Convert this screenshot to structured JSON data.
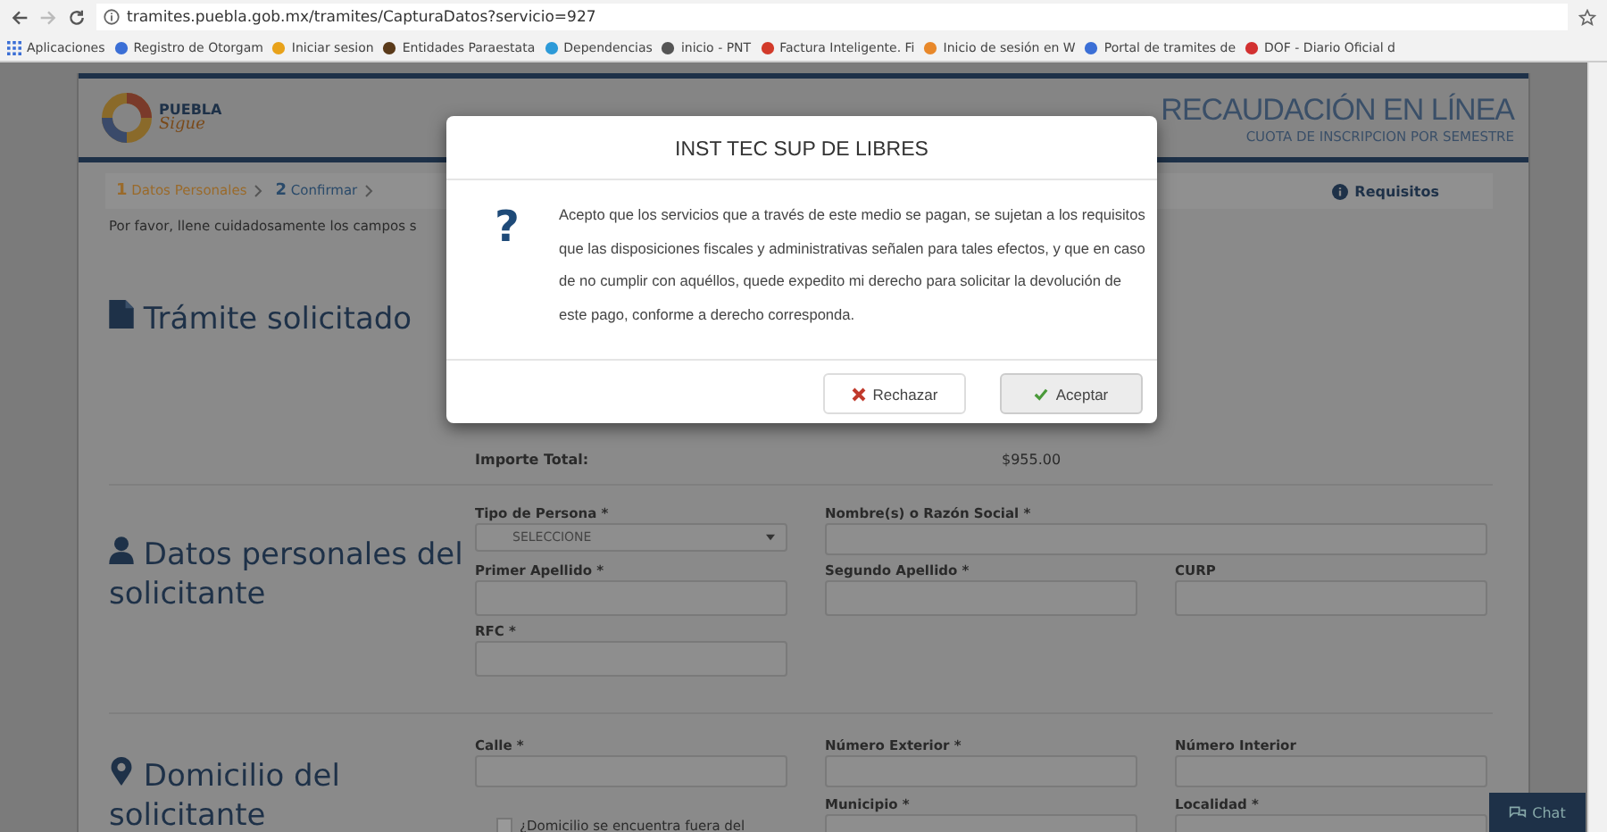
{
  "browser": {
    "url": "tramites.puebla.gob.mx/tramites/CapturaDatos?servicio=927",
    "bookmarks": [
      "Aplicaciones",
      "Registro de Otorgam",
      "Iniciar sesion",
      "Entidades Paraestata",
      "Dependencias",
      "inicio - PNT",
      "Factura Inteligente. Fi",
      "Inicio de sesión en W",
      "Portal de tramites de",
      "DOF - Diario Oficial d"
    ]
  },
  "header": {
    "logo_title": "PUEBLA",
    "logo_subtitle": "Sigue",
    "title": "RECAUDACIÓN EN LÍNEA",
    "subtitle": "CUOTA DE INSCRIPCION POR SEMESTRE"
  },
  "steps": [
    {
      "number": "1",
      "label": "Datos Personales",
      "selected": true
    },
    {
      "number": "2",
      "label": "Confirmar",
      "selected": false
    }
  ],
  "requisitos": "Requisitos",
  "instructions": "Por favor, llene cuidadosamente los campos s",
  "sections": [
    {
      "kind": "file",
      "title": "Trámite solicitado",
      "summary": {
        "label": "Importe Total:",
        "value": "$955.00"
      }
    },
    {
      "kind": "user",
      "title": "Datos personales del solicitante",
      "fields": [
        {
          "kind": "select",
          "label": "Tipo de Persona *",
          "value": "SELECCIONE"
        },
        {
          "kind": "wide-input",
          "label": "Nombre(s) o Razón Social *"
        },
        {
          "kind": "input",
          "label": "Primer Apellido *"
        },
        {
          "kind": "input",
          "label": "Segundo Apellido *"
        },
        {
          "kind": "input",
          "label": "CURP"
        },
        {
          "kind": "input",
          "label": "RFC *"
        }
      ]
    },
    {
      "kind": "pin",
      "title": "Domicilio del solicitante",
      "fields": [
        {
          "kind": "input",
          "label": "Calle *"
        },
        {
          "kind": "input",
          "label": "Número Exterior *"
        },
        {
          "kind": "input",
          "label": "Número Interior"
        },
        {
          "kind": "checkbox",
          "label": "¿Domicilio se encuentra fuera del",
          "checked": false
        },
        {
          "kind": "input",
          "label": "Municipio *"
        },
        {
          "kind": "input",
          "label": "Localidad *"
        }
      ]
    }
  ],
  "modal": {
    "title": "INST TEC SUP DE LIBRES",
    "icon_text": "?",
    "message": "Acepto que los servicios que a través de este medio se pagan, se sujetan a los requisitos que las disposiciones fiscales y administrativas señalen para tales efectos, y que en caso de no cumplir con aquéllos, quede expedito mi derecho para solicitar la devolución de este pago, conforme a derecho corresponda.",
    "buttons": [
      {
        "kind": "reject",
        "label": "Rechazar"
      },
      {
        "kind": "accept",
        "label": "Aceptar"
      }
    ]
  },
  "chat": {
    "label": "Chat"
  }
}
